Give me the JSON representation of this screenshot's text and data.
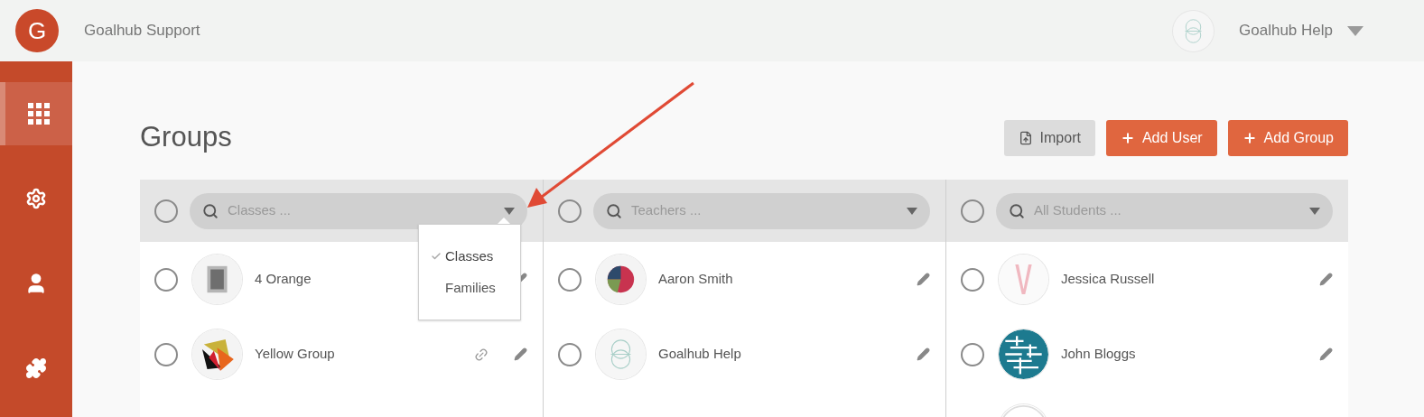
{
  "app": {
    "logo": "G",
    "title": "Goalhub Support"
  },
  "user": {
    "name": "Goalhub Help"
  },
  "sidebar": {
    "items": [
      {
        "kind": "grid",
        "selected": true
      },
      {
        "kind": "settings",
        "selected": false
      },
      {
        "kind": "user",
        "selected": false
      },
      {
        "kind": "puzzle",
        "selected": false
      }
    ]
  },
  "page": {
    "title": "Groups",
    "buttons": [
      {
        "kind": "import",
        "label": "Import"
      },
      {
        "kind": "add",
        "label": "Add User"
      },
      {
        "kind": "add",
        "label": "Add Group"
      }
    ]
  },
  "columns": [
    {
      "placeholder": "Classes ...",
      "checked": false,
      "menu": [
        {
          "label": "Classes",
          "selected": true
        },
        {
          "label": "Families",
          "selected": false
        }
      ],
      "rows": [
        {
          "kind": "member",
          "name": "4 Orange",
          "checked": false,
          "link": false
        },
        {
          "kind": "member",
          "name": "Yellow Group",
          "checked": false,
          "link": true
        }
      ]
    },
    {
      "placeholder": "Teachers ...",
      "checked": false,
      "rows": [
        {
          "kind": "member",
          "name": "Aaron Smith",
          "checked": false,
          "link": false
        },
        {
          "kind": "member",
          "name": "Goalhub Help",
          "checked": false,
          "link": false
        }
      ]
    },
    {
      "placeholder": "All Students ...",
      "checked": false,
      "rows": [
        {
          "kind": "member",
          "name": "Jessica Russell",
          "checked": false,
          "link": false
        },
        {
          "kind": "member",
          "name": "John Bloggs",
          "checked": false,
          "link": false
        },
        {
          "kind": "partial"
        }
      ]
    }
  ]
}
